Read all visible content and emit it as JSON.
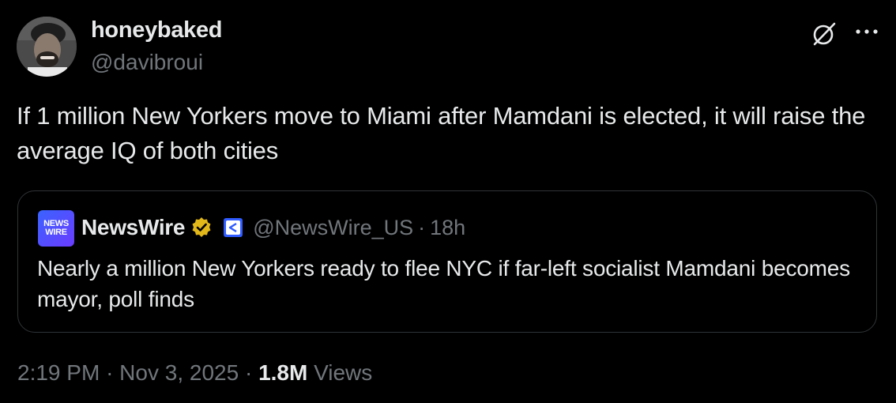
{
  "author": {
    "display_name": "honeybaked",
    "handle": "@davibroui"
  },
  "tweet": {
    "text": "If 1 million New Yorkers move to Miami after Mamdani is elected, it will raise the average IQ of both cities"
  },
  "quote": {
    "avatar_line1": "NEWS",
    "avatar_line2": "WIRE",
    "name": "NewsWire",
    "handle": "@NewsWire_US",
    "separator": "·",
    "time": "18h",
    "text": "Nearly a million New Yorkers ready to flee NYC if far-left socialist Mamdani becomes mayor, poll finds"
  },
  "meta": {
    "time": "2:19 PM",
    "separator1": "·",
    "date": "Nov 3, 2025",
    "separator2": "·",
    "views_count": "1.8M",
    "views_label": "Views"
  },
  "icons": {
    "grok": "grok-icon",
    "more": "more-icon",
    "verified": "verified-badge-icon",
    "affiliate": "affiliate-badge-icon"
  },
  "colors": {
    "background": "#000000",
    "primary_text": "#e7e9ea",
    "secondary_text": "#71767b",
    "border": "#2f3336",
    "verified_gold": "#e2b719"
  }
}
